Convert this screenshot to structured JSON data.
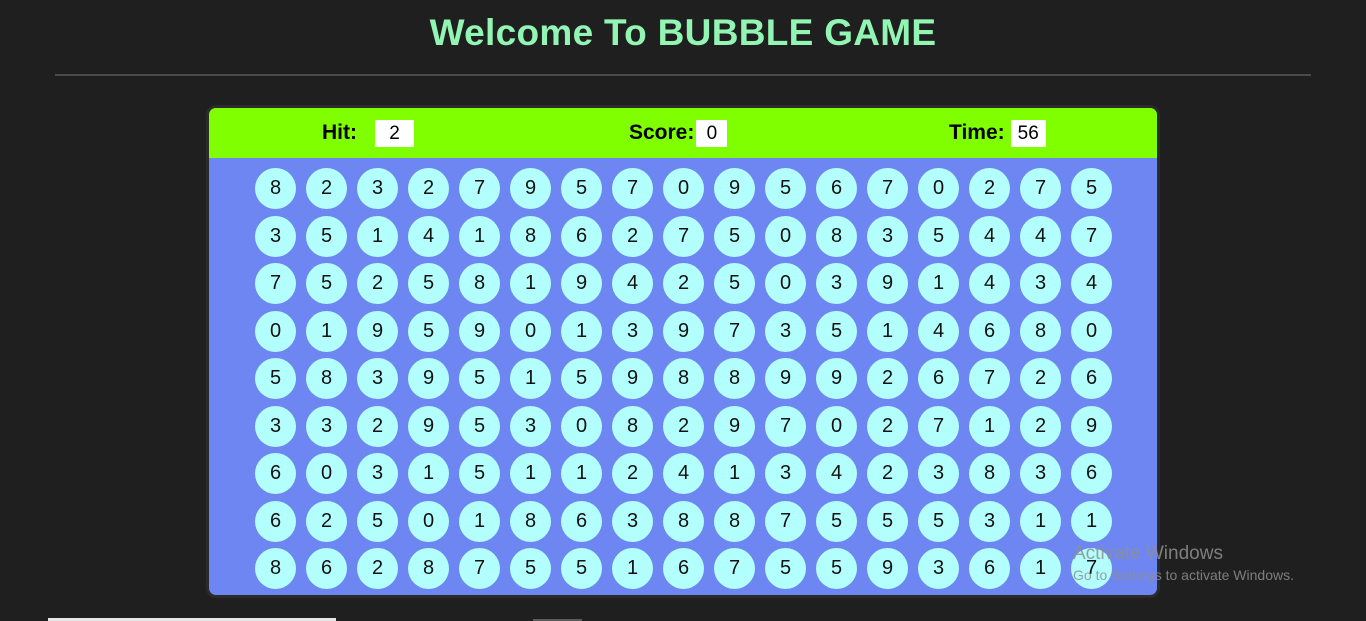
{
  "page": {
    "title": "Welcome To BUBBLE GAME"
  },
  "stats": {
    "hit_label": "Hit:",
    "hit_value": "2",
    "score_label": "Score:",
    "score_value": "0",
    "time_label": "Time:",
    "time_value": "56"
  },
  "bubbles": [
    [
      "8",
      "2",
      "3",
      "2",
      "7",
      "9",
      "5",
      "7",
      "0",
      "9",
      "5",
      "6",
      "7",
      "0",
      "2",
      "7",
      "5"
    ],
    [
      "3",
      "5",
      "1",
      "4",
      "1",
      "8",
      "6",
      "2",
      "7",
      "5",
      "0",
      "8",
      "3",
      "5",
      "4",
      "4",
      "7"
    ],
    [
      "7",
      "5",
      "2",
      "5",
      "8",
      "1",
      "9",
      "4",
      "2",
      "5",
      "0",
      "3",
      "9",
      "1",
      "4",
      "3",
      "4"
    ],
    [
      "0",
      "1",
      "9",
      "5",
      "9",
      "0",
      "1",
      "3",
      "9",
      "7",
      "3",
      "5",
      "1",
      "4",
      "6",
      "8",
      "0"
    ],
    [
      "5",
      "8",
      "3",
      "9",
      "5",
      "1",
      "5",
      "9",
      "8",
      "8",
      "9",
      "9",
      "2",
      "6",
      "7",
      "2",
      "6"
    ],
    [
      "3",
      "3",
      "2",
      "9",
      "5",
      "3",
      "0",
      "8",
      "2",
      "9",
      "7",
      "0",
      "2",
      "7",
      "1",
      "2",
      "9"
    ],
    [
      "6",
      "0",
      "3",
      "1",
      "5",
      "1",
      "1",
      "2",
      "4",
      "1",
      "3",
      "4",
      "2",
      "3",
      "8",
      "3",
      "6"
    ],
    [
      "6",
      "2",
      "5",
      "0",
      "1",
      "8",
      "6",
      "3",
      "8",
      "8",
      "7",
      "5",
      "5",
      "5",
      "3",
      "1",
      "1"
    ],
    [
      "8",
      "6",
      "2",
      "8",
      "7",
      "5",
      "5",
      "1",
      "6",
      "7",
      "5",
      "5",
      "9",
      "3",
      "6",
      "1",
      "7"
    ]
  ],
  "watermark": {
    "title": "Activate Windows",
    "subtitle": "Go to Settings to activate Windows."
  },
  "colors": {
    "background": "#1f1f1f",
    "title": "#93f5b3",
    "topbar": "#80ff00",
    "panel": "#6e86f2",
    "bubble": "#b3fffd"
  }
}
